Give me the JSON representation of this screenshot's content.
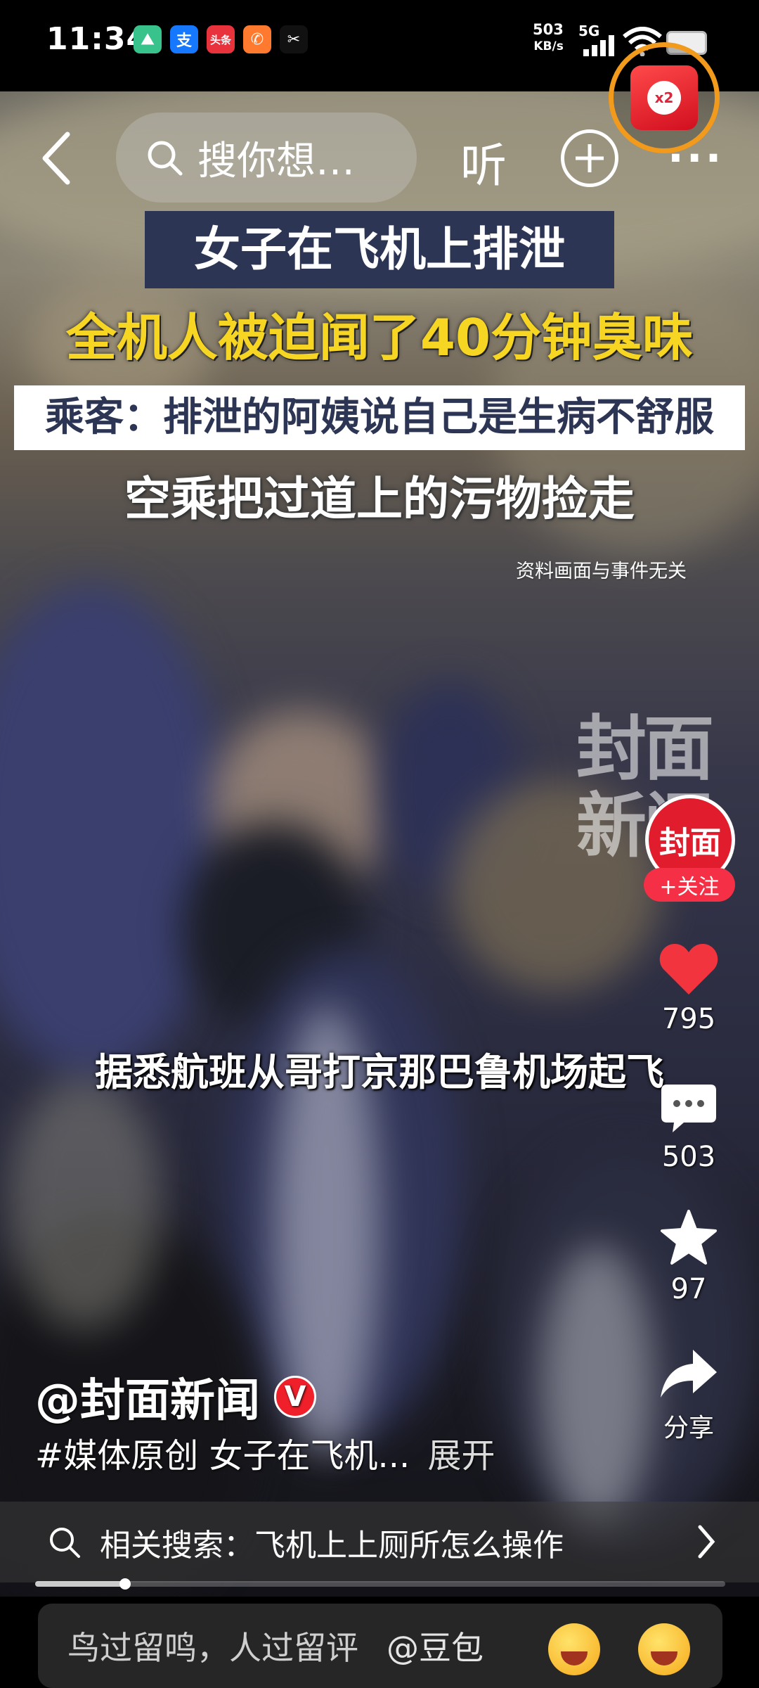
{
  "status_bar": {
    "time": "11:34",
    "net_speed_value": "503",
    "net_speed_unit": "KB/s",
    "network": "5G",
    "notification_icons": [
      {
        "name": "notif-app-green-icon",
        "glyph": "⛰",
        "color": "#39c38c"
      },
      {
        "name": "alipay-icon",
        "glyph": "支",
        "color": "#1677ff"
      },
      {
        "name": "toutiao-icon",
        "glyph": "头条",
        "color": "#e8323c"
      },
      {
        "name": "notif-app-orange-icon",
        "glyph": "✆",
        "color": "#ff7a2e"
      },
      {
        "name": "capcut-icon",
        "glyph": "✂",
        "color": "#111111"
      }
    ]
  },
  "top_nav": {
    "search_placeholder": "搜你想…",
    "listen_label": "听",
    "redpack_multiplier": "x2"
  },
  "video": {
    "headline_1": "女子在飞机上排泄",
    "headline_2": "全机人被迫闻了40分钟臭味",
    "headline_3": "乘客：排泄的阿姨说自己是生病不舒服",
    "headline_4": "空乘把过道上的污物捡走",
    "disclaimer": "资料画面与事件无关",
    "watermark": "封面\n新闻",
    "subtitle": "据悉航班从哥打京那巴鲁机场起飞"
  },
  "actions": {
    "avatar_text": "封面",
    "follow_label": "+关注",
    "likes": "795",
    "comments": "503",
    "favorites": "97",
    "share_label": "分享"
  },
  "post": {
    "author": "@封面新闻",
    "verified_badge": "V",
    "caption": "#媒体原创 女子在飞机...",
    "expand_label": "展开",
    "related_search": "相关搜索：飞机上上厕所怎么操作",
    "progress": 0.13
  },
  "comment_bar": {
    "placeholder": "鸟过留鸣，人过留评",
    "mention": "@豆包"
  }
}
